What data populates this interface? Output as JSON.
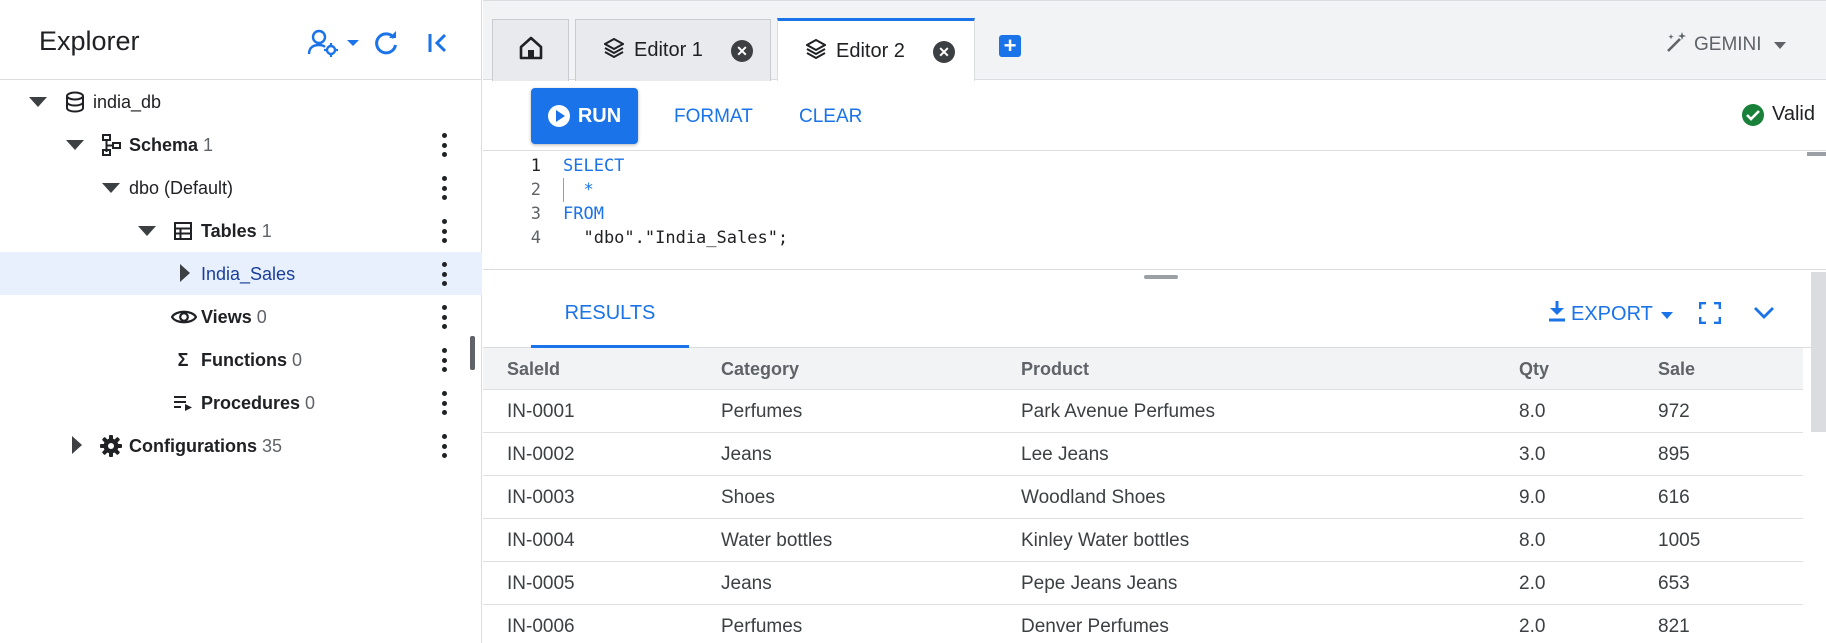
{
  "explorer": {
    "title": "Explorer",
    "tree": [
      {
        "label": "india_db",
        "count": ""
      },
      {
        "label": "Schema",
        "count": "1"
      },
      {
        "label": "dbo (Default)",
        "count": ""
      },
      {
        "label": "Tables",
        "count": "1"
      },
      {
        "label": "India_Sales",
        "count": ""
      },
      {
        "label": "Views",
        "count": "0"
      },
      {
        "label": "Functions",
        "count": "0"
      },
      {
        "label": "Procedures",
        "count": "0"
      },
      {
        "label": "Configurations",
        "count": "35"
      }
    ]
  },
  "tabs": [
    {
      "label": "Editor 1"
    },
    {
      "label": "Editor 2"
    }
  ],
  "gemini_label": "GEMINI",
  "toolbar": {
    "run_label": "RUN",
    "format_label": "FORMAT",
    "clear_label": "CLEAR",
    "status": "Valid"
  },
  "editor": {
    "lines": [
      {
        "num": "1",
        "text": "SELECT"
      },
      {
        "num": "2",
        "text": "  *"
      },
      {
        "num": "3",
        "text": "FROM"
      },
      {
        "num": "4",
        "text": "  \"dbo\".\"India_Sales\";"
      }
    ]
  },
  "results": {
    "tab_label": "RESULTS",
    "export_label": "EXPORT",
    "columns": [
      "SaleId",
      "Category",
      "Product",
      "Qty",
      "Sale"
    ],
    "rows": [
      [
        "IN-0001",
        "Perfumes",
        "Park Avenue Perfumes",
        "8.0",
        "972"
      ],
      [
        "IN-0002",
        "Jeans",
        "Lee Jeans",
        "3.0",
        "895"
      ],
      [
        "IN-0003",
        "Shoes",
        "Woodland Shoes",
        "9.0",
        "616"
      ],
      [
        "IN-0004",
        "Water bottles",
        "Kinley Water bottles",
        "8.0",
        "1005"
      ],
      [
        "IN-0005",
        "Jeans",
        "Pepe Jeans Jeans",
        "2.0",
        "653"
      ],
      [
        "IN-0006",
        "Perfumes",
        "Denver Perfumes",
        "2.0",
        "821"
      ]
    ]
  },
  "colors": {
    "accent": "#1a73e8",
    "selected_row": "#e8f0fe",
    "valid": "#188038"
  }
}
